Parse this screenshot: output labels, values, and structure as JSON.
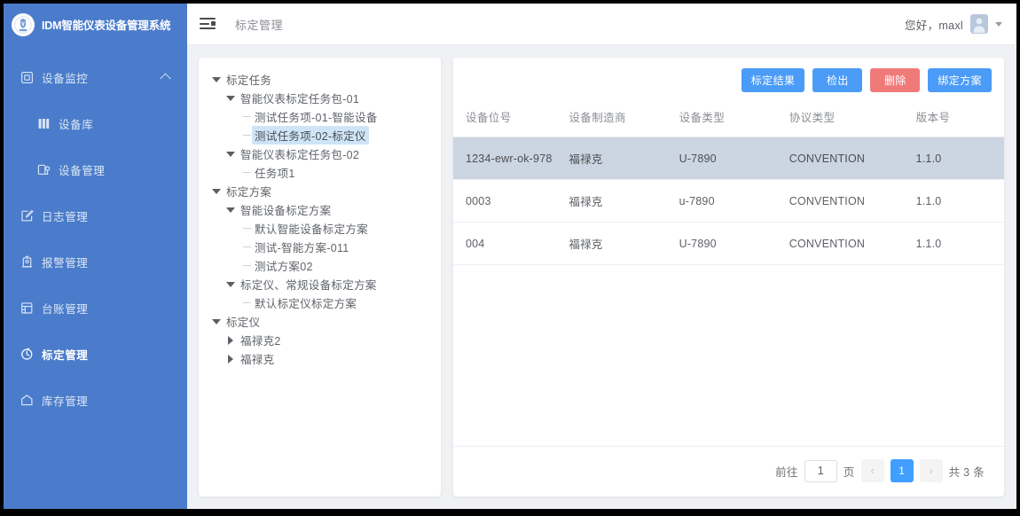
{
  "app": {
    "brand_title": "IDM智能仪表设备管理系统",
    "breadcrumb": "标定管理",
    "greeting": "您好，maxl",
    "accent_blue": "#4a7ccb",
    "button_blue": "#4b9cf7",
    "button_red": "#f07a78"
  },
  "sidebar": {
    "items": [
      {
        "label": "设备监控",
        "icon": "monitor-icon",
        "level": 0,
        "active": false,
        "expandable": true
      },
      {
        "label": "设备库",
        "icon": "library-icon",
        "level": 1,
        "active": false,
        "expandable": false
      },
      {
        "label": "设备管理",
        "icon": "device-manage-icon",
        "level": 1,
        "active": false,
        "expandable": false
      },
      {
        "label": "日志管理",
        "icon": "log-icon",
        "level": 0,
        "active": false,
        "expandable": false
      },
      {
        "label": "报警管理",
        "icon": "alarm-icon",
        "level": 0,
        "active": false,
        "expandable": false
      },
      {
        "label": "台账管理",
        "icon": "ledger-icon",
        "level": 0,
        "active": false,
        "expandable": false
      },
      {
        "label": "标定管理",
        "icon": "calibration-icon",
        "level": 0,
        "active": true,
        "expandable": false
      },
      {
        "label": "库存管理",
        "icon": "inventory-icon",
        "level": 0,
        "active": false,
        "expandable": false
      }
    ]
  },
  "tree": {
    "nodes": [
      {
        "label": "标定任务",
        "indent": 0,
        "state": "down",
        "selected": false
      },
      {
        "label": "智能仪表标定任务包-01",
        "indent": 1,
        "state": "down",
        "selected": false
      },
      {
        "label": "测试任务项-01-智能设备",
        "indent": 2,
        "state": "leaf",
        "selected": false
      },
      {
        "label": "测试任务项-02-标定仪",
        "indent": 2,
        "state": "leaf",
        "selected": true
      },
      {
        "label": "智能仪表标定任务包-02",
        "indent": 1,
        "state": "down",
        "selected": false
      },
      {
        "label": "任务项1",
        "indent": 2,
        "state": "leaf",
        "selected": false
      },
      {
        "label": "标定方案",
        "indent": 0,
        "state": "down",
        "selected": false
      },
      {
        "label": "智能设备标定方案",
        "indent": 1,
        "state": "down",
        "selected": false
      },
      {
        "label": "默认智能设备标定方案",
        "indent": 2,
        "state": "leaf",
        "selected": false
      },
      {
        "label": "测试-智能方案-011",
        "indent": 2,
        "state": "leaf",
        "selected": false
      },
      {
        "label": "测试方案02",
        "indent": 2,
        "state": "leaf",
        "selected": false
      },
      {
        "label": "标定仪、常规设备标定方案",
        "indent": 1,
        "state": "down",
        "selected": false
      },
      {
        "label": "默认标定仪标定方案",
        "indent": 2,
        "state": "leaf",
        "selected": false
      },
      {
        "label": "标定仪",
        "indent": 0,
        "state": "down",
        "selected": false
      },
      {
        "label": "福禄克2",
        "indent": 1,
        "state": "right",
        "selected": false
      },
      {
        "label": "福禄克",
        "indent": 1,
        "state": "right",
        "selected": false
      }
    ]
  },
  "toolbar": {
    "buttons": [
      {
        "label": "标定结果",
        "style": "primary"
      },
      {
        "label": "检出",
        "style": "primary"
      },
      {
        "label": "删除",
        "style": "danger"
      },
      {
        "label": "绑定方案",
        "style": "primary"
      }
    ]
  },
  "table": {
    "columns": [
      "设备位号",
      "设备制造商",
      "设备类型",
      "协议类型",
      "版本号"
    ],
    "rows": [
      {
        "cells": [
          "1234-ewr-ok-978",
          "福禄克",
          "U-7890",
          "CONVENTION",
          "1.1.0"
        ],
        "selected": true
      },
      {
        "cells": [
          "0003",
          "福禄克",
          "u-7890",
          "CONVENTION",
          "1.1.0"
        ],
        "selected": false
      },
      {
        "cells": [
          "004",
          "福禄克",
          "U-7890",
          "CONVENTION",
          "1.1.0"
        ],
        "selected": false
      }
    ]
  },
  "pagination": {
    "goto_label": "前往",
    "page_value": "1",
    "page_unit": "页",
    "prev_glyph": "‹",
    "next_glyph": "›",
    "current_page": "1",
    "total_label": "共 3 条"
  }
}
